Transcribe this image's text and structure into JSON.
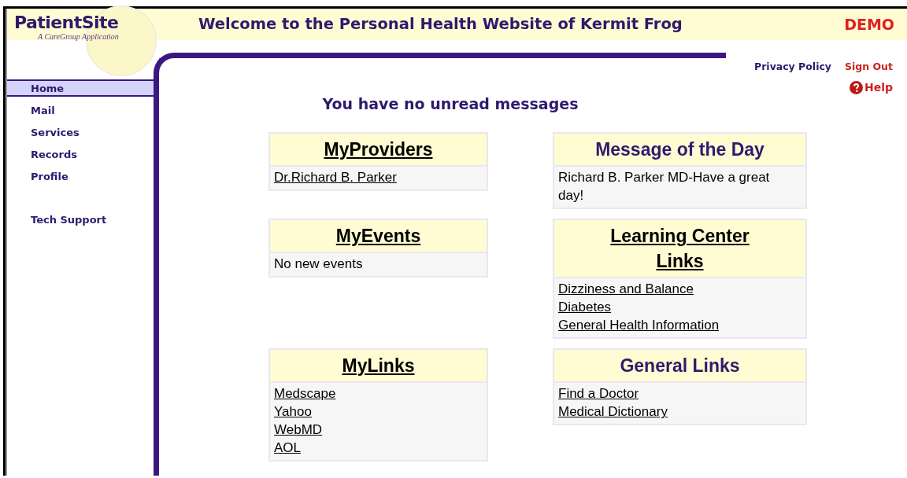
{
  "header": {
    "logo": "PatientSite",
    "tagline": "A CareGroup Application",
    "title": "Welcome to the Personal Health Website of Kermit Frog",
    "badge": "DEMO"
  },
  "top_links": [
    {
      "text": "Privacy Policy",
      "kind": "normal"
    },
    {
      "text": "Sign Out",
      "kind": "alert"
    }
  ],
  "help": "Help",
  "sidebar": {
    "items": [
      {
        "label": "Home",
        "selected": true
      },
      {
        "label": "Mail",
        "selected": false
      },
      {
        "label": "Services",
        "selected": false
      },
      {
        "label": "Records",
        "selected": false
      },
      {
        "label": "Profile",
        "selected": false
      }
    ],
    "support_items": [
      {
        "label": "Tech Support",
        "selected": false
      }
    ]
  },
  "heading": "You have no unread messages",
  "panels": [
    {
      "title": {
        "text": "MyProviders",
        "kind": "link"
      },
      "items": [
        {
          "text": "Dr.Richard B. Parker",
          "kind": "link"
        }
      ]
    },
    {
      "title": {
        "text": "Message of the Day",
        "kind": "plain"
      },
      "items": [
        {
          "text": "Richard B. Parker MD-Have a great day!",
          "kind": "text"
        }
      ]
    },
    {
      "title": {
        "text": "MyEvents",
        "kind": "link"
      },
      "items": [
        {
          "text": "No new events",
          "kind": "text"
        }
      ]
    },
    {
      "title": {
        "text": "Learning Center Links",
        "kind": "link"
      },
      "items": [
        {
          "text": "Dizziness and Balance",
          "kind": "link"
        },
        {
          "text": "Diabetes",
          "kind": "link"
        },
        {
          "text": "General Health Information",
          "kind": "link"
        }
      ]
    },
    {
      "title": {
        "text": "MyLinks",
        "kind": "link"
      },
      "items": [
        {
          "text": "Medscape",
          "kind": "link"
        },
        {
          "text": "Yahoo",
          "kind": "link"
        },
        {
          "text": "WebMD",
          "kind": "link"
        },
        {
          "text": "AOL",
          "kind": "link"
        }
      ]
    },
    {
      "title": {
        "text": "General Links",
        "kind": "plain"
      },
      "items": [
        {
          "text": "Find a Doctor",
          "kind": "link"
        },
        {
          "text": "Medical Dictionary",
          "kind": "link"
        }
      ]
    }
  ]
}
